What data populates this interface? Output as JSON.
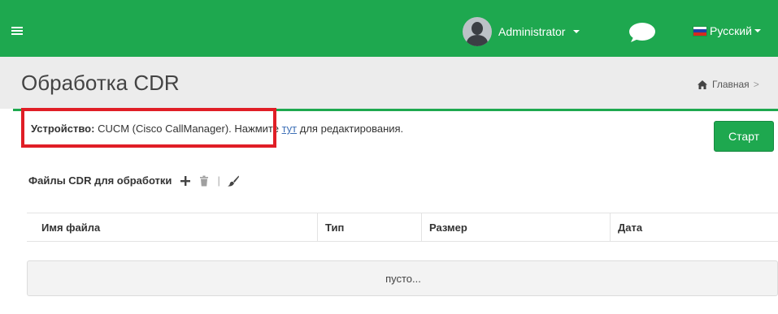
{
  "topbar": {
    "user_name": "Administrator",
    "language": "Русский",
    "colors": {
      "bar": "#1ea84f"
    }
  },
  "header": {
    "title": "Обработка CDR",
    "breadcrumb_home": "Главная",
    "breadcrumb_separator": ">"
  },
  "device": {
    "label": "Устройство:",
    "value": "CUCM (Cisco CallManager).",
    "prompt_before": "Нажмите",
    "link_text": "тут",
    "prompt_after": "для редактирования."
  },
  "actions": {
    "start_label": "Старт"
  },
  "files": {
    "title": "Файлы CDR для обработки",
    "icons": [
      "plus-icon",
      "trash-icon",
      "brush-icon"
    ],
    "separator": "|"
  },
  "table": {
    "columns": [
      "Имя файла",
      "Тип",
      "Размер",
      "Дата"
    ],
    "empty_text": "пусто..."
  },
  "colors": {
    "accent": "#1ea84f",
    "highlight": "#e01e26",
    "link": "#3c6fb6"
  }
}
